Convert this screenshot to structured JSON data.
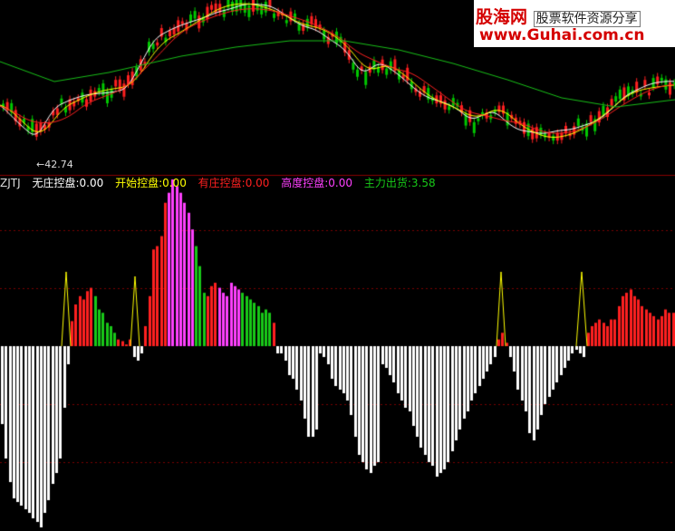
{
  "watermark": {
    "brand": "股海网",
    "tagline": "股票软件资源分享",
    "url": "www.Guhai.com.cn"
  },
  "price_panel": {
    "low_label": "←42.74",
    "colors": {
      "up": "#00c800",
      "down": "#ff2020",
      "ma_short": "#ffffff",
      "ma_mid": "#ffff00",
      "ma_long1": "#ff2020",
      "ma_long2": "#18c018"
    }
  },
  "indicator": {
    "name": "ZJTJ",
    "items": [
      {
        "label": "无庄控盘:0.00",
        "color": "#ffffff"
      },
      {
        "label": "开始控盘:0.00",
        "color": "#ffff00"
      },
      {
        "label": "有庄控盘:0.00",
        "color": "#ff2020"
      },
      {
        "label": "高度控盘:0.00",
        "color": "#ff40ff"
      },
      {
        "label": "主力出货:3.58",
        "color": "#18c818"
      }
    ]
  },
  "chart_data": {
    "type": "bar",
    "title": "ZJTJ",
    "ylim": [
      -100,
      100
    ],
    "series_colors": {
      "none": "#ffffff",
      "start": "#ffff00",
      "control": "#ff2020",
      "high": "#ff40ff",
      "sell": "#18c818"
    },
    "bars": [
      -43,
      -62,
      -75,
      -84,
      -86,
      -88,
      -90,
      -92,
      -95,
      -97,
      -100,
      -92,
      -85,
      -76,
      -70,
      -62,
      -34,
      -10,
      15,
      25,
      30,
      28,
      33,
      35,
      30,
      22,
      20,
      14,
      12,
      8,
      4,
      3,
      1,
      4,
      -6,
      -8,
      -4,
      12,
      30,
      58,
      60,
      66,
      86,
      92,
      100,
      96,
      92,
      86,
      80,
      70,
      60,
      48,
      32,
      30,
      36,
      38,
      35,
      32,
      30,
      38,
      36,
      34,
      32,
      30,
      28,
      26,
      24,
      20,
      22,
      20,
      14,
      -4,
      -4,
      -8,
      -16,
      -18,
      -24,
      -30,
      -40,
      -50,
      -50,
      -46,
      -4,
      -6,
      -10,
      -18,
      -22,
      -24,
      -26,
      -30,
      -38,
      -50,
      -60,
      -64,
      -68,
      -70,
      -66,
      -64,
      -10,
      -12,
      -16,
      -20,
      -26,
      -30,
      -34,
      -36,
      -44,
      -50,
      -56,
      -60,
      -64,
      -66,
      -72,
      -70,
      -68,
      -64,
      -58,
      -52,
      -46,
      -40,
      -36,
      -30,
      -26,
      -22,
      -18,
      -14,
      -10,
      -6,
      4,
      8,
      2,
      -6,
      -14,
      -24,
      -30,
      -36,
      -48,
      -52,
      -46,
      -38,
      -32,
      -28,
      -24,
      -20,
      -16,
      -12,
      -8,
      -4,
      -2,
      -4,
      -6,
      8,
      12,
      14,
      16,
      14,
      12,
      16,
      16,
      24,
      30,
      32,
      34,
      30,
      28,
      24,
      22,
      20,
      18,
      16,
      18,
      22,
      20,
      20
    ],
    "bar_colors": "w18,r19,e30"
  }
}
